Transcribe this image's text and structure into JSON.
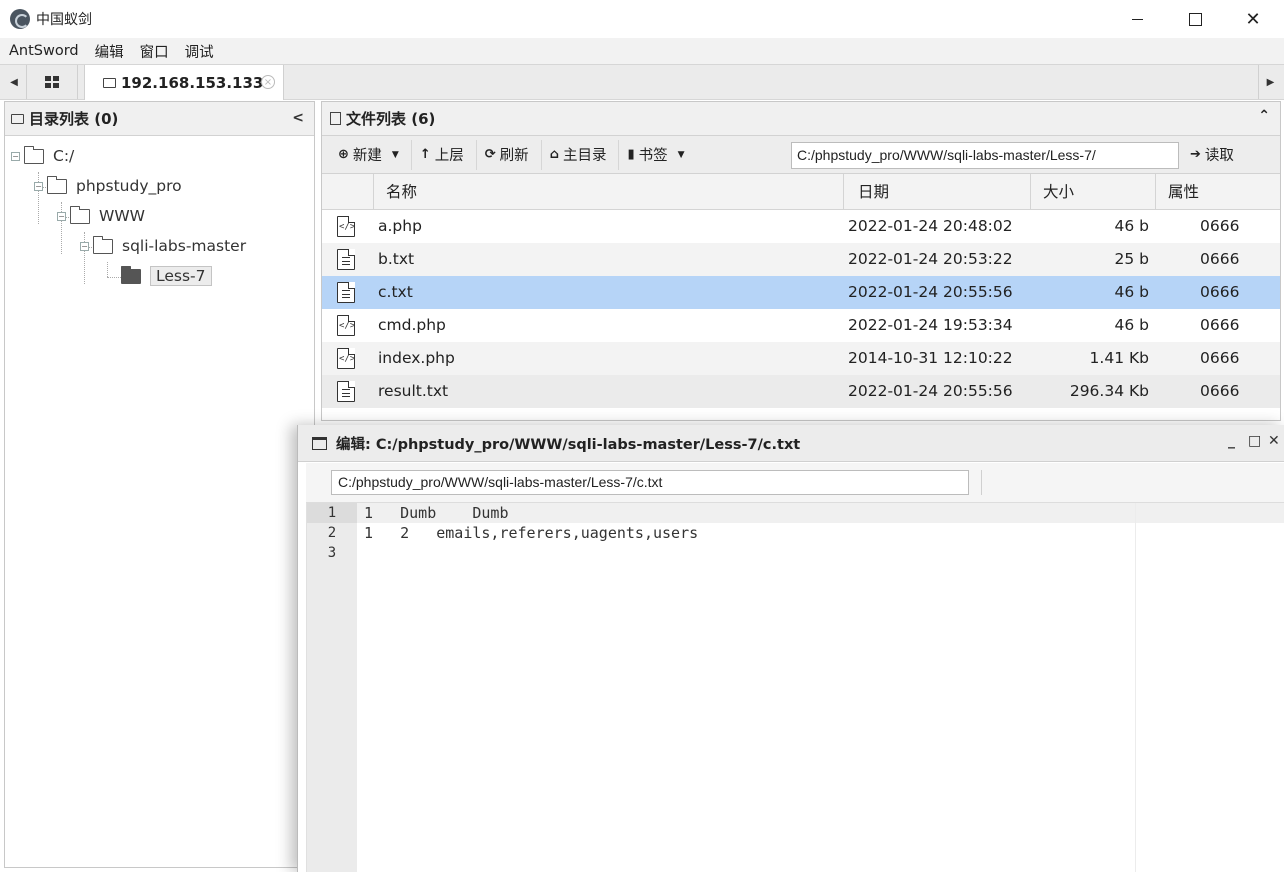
{
  "window": {
    "title": "中国蚁剑"
  },
  "menu": [
    "AntSword",
    "编辑",
    "窗口",
    "调试"
  ],
  "tabs": {
    "active_label": "192.168.153.133",
    "close_glyph": "×"
  },
  "dir_panel": {
    "title": "目录列表 (0)",
    "tree": [
      "C:/",
      "phpstudy_pro",
      "WWW",
      "sqli-labs-master",
      "Less-7"
    ]
  },
  "file_panel": {
    "title": "文件列表 (6)",
    "toolbar": {
      "new_label": "新建",
      "up_label": "上层",
      "refresh_label": "刷新",
      "home_label": "主目录",
      "bookmark_label": "书签",
      "path_value": "C:/phpstudy_pro/WWW/sqli-labs-master/Less-7/",
      "read_label": "读取"
    },
    "columns": {
      "name": "名称",
      "date": "日期",
      "size": "大小",
      "attr": "属性"
    },
    "files": [
      {
        "name": "a.php",
        "date": "2022-01-24 20:48:02",
        "size": "46 b",
        "attr": "0666",
        "type": "code"
      },
      {
        "name": "b.txt",
        "date": "2022-01-24 20:53:22",
        "size": "25 b",
        "attr": "0666",
        "type": "text"
      },
      {
        "name": "c.txt",
        "date": "2022-01-24 20:55:56",
        "size": "46 b",
        "attr": "0666",
        "type": "text"
      },
      {
        "name": "cmd.php",
        "date": "2022-01-24 19:53:34",
        "size": "46 b",
        "attr": "0666",
        "type": "code"
      },
      {
        "name": "index.php",
        "date": "2014-10-31 12:10:22",
        "size": "1.41 Kb",
        "attr": "0666",
        "type": "code"
      },
      {
        "name": "result.txt",
        "date": "2022-01-24 20:55:56",
        "size": "296.34 Kb",
        "attr": "0666",
        "type": "text"
      }
    ]
  },
  "editor": {
    "title": "编辑: C:/phpstudy_pro/WWW/sqli-labs-master/Less-7/c.txt",
    "path_value": "C:/phpstudy_pro/WWW/sqli-labs-master/Less-7/c.txt",
    "gutter": [
      "1",
      "2",
      "3"
    ],
    "lines": [
      "1   Dumb    Dumb",
      "1   2   emails,referers,uagents,users",
      ""
    ]
  },
  "colors": {
    "selected_row": "#b6d4f7",
    "header_bg": "#f0f0f0"
  }
}
